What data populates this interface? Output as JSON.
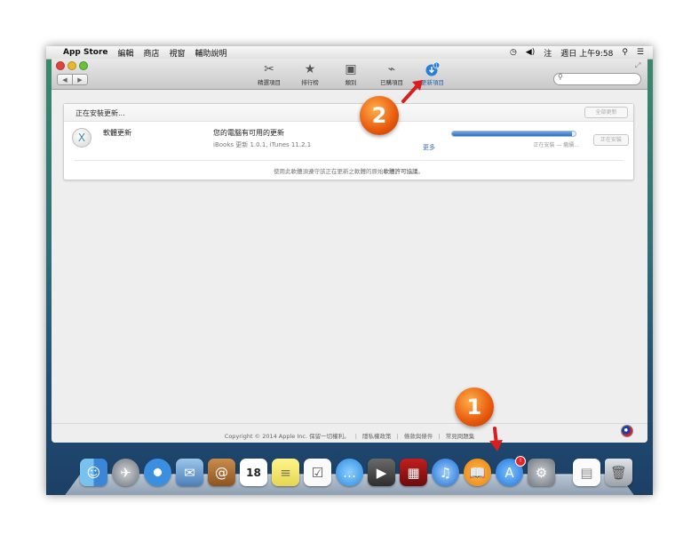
{
  "menubar": {
    "apple": "",
    "app_name": "App Store",
    "items": [
      "編輯",
      "商店",
      "視窗",
      "輔助說明"
    ],
    "input_method": "注",
    "clock": "週日 上午9:58"
  },
  "toolbar": {
    "items": [
      {
        "label": "精選項目",
        "icon": "scissors-icon"
      },
      {
        "label": "排行榜",
        "icon": "star-icon"
      },
      {
        "label": "類別",
        "icon": "box-icon"
      },
      {
        "label": "已購項目",
        "icon": "tag-icon"
      },
      {
        "label": "更新項目",
        "icon": "update-download-icon",
        "badge": "1",
        "active": true
      }
    ],
    "search_placeholder": ""
  },
  "panel": {
    "title": "正在安裝更新...",
    "update_all_button": "全部更新",
    "row": {
      "name": "軟體更新",
      "heading": "您的電腦有可用的更新",
      "subtitle": "iBooks 更新 1.0.1, iTunes 11.2.1",
      "more_link": "更多",
      "status": "正在安裝 — 繼續...",
      "progress_percent": 97,
      "install_button": "正在安裝"
    },
    "license_text": "使用此軟體須遵守該正在更新之軟體的原始",
    "license_link": "軟體許可協議",
    "license_end": "。"
  },
  "footer": {
    "copyright": "Copyright © 2014 Apple Inc. 保留一切權利。",
    "privacy": "隱私權政策",
    "terms": "條款與條件",
    "faq": "常見問題集"
  },
  "dock": {
    "calendar_day": "18",
    "appstore_badge": "!"
  },
  "callouts": {
    "one": "1",
    "two": "2"
  },
  "colors": {
    "callout_orange": "#e8590c",
    "arrow_red": "#d81e1e",
    "accent_blue": "#2a7ed8"
  }
}
